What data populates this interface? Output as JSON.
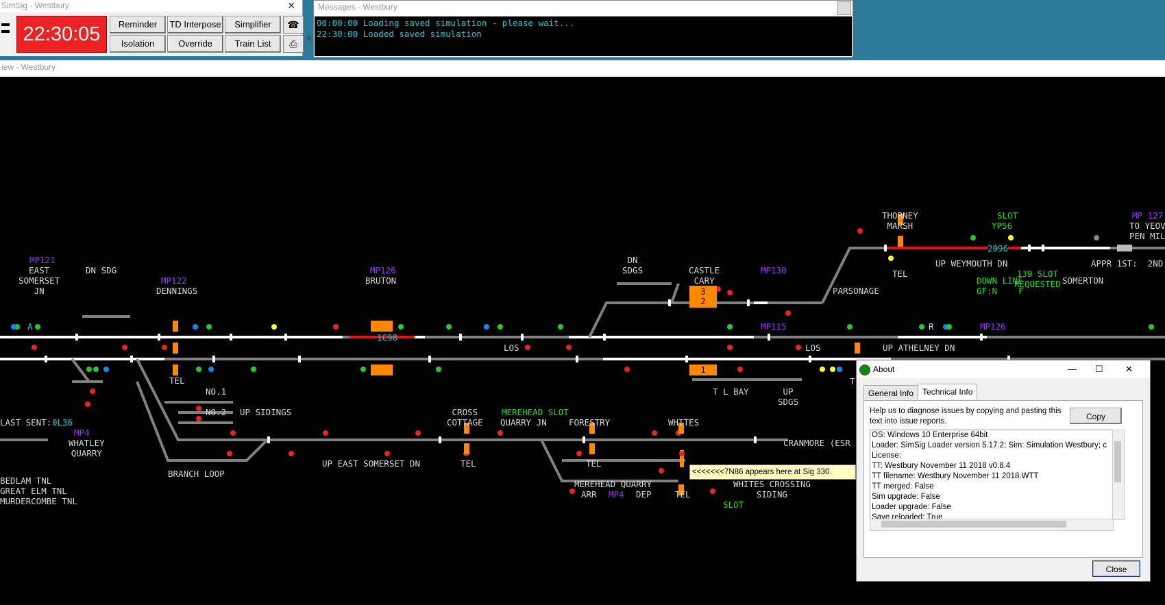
{
  "control": {
    "title": "SimSig - Westbury",
    "clock": "22:30:05",
    "buttons": {
      "reminder": "Reminder",
      "td_interpose": "TD Interpose",
      "simplifier": "Simplifier",
      "isolation": "Isolation",
      "override": "Override",
      "train_list": "Train List"
    },
    "side_char": "6"
  },
  "messages": {
    "title": "Messages - Westbury",
    "lines": [
      "00:00:00 Loading saved simulation - please wait...",
      "22:30:00 Loaded saved simulation"
    ]
  },
  "view": {
    "title": "iew - Westbury",
    "colors": {
      "track_white": "#ffffff",
      "track_grey": "#808080",
      "route_red": "#ee1111",
      "berth": "#ff8800",
      "mp_label": "#9933ff",
      "green_text": "#22dd22",
      "cyan_text": "#22cccc"
    },
    "labels": {
      "mp121": "MP121",
      "east_somerset": "EAST\nSOMERSET\nJN",
      "dn_sdg": "DN SDG",
      "mp122": "MP122",
      "dennings": "DENNINGS",
      "mp126a": "MP126",
      "bruton": "BRUTON",
      "dn_sdgs": "DN\nSDGS",
      "castle_cary": "CASTLE\nCARY",
      "mp130": "MP130",
      "mp115": "MP115",
      "parsonage": "PARSONAGE",
      "down_line": "DOWN LINE",
      "gf_n": "GF:N",
      "f": "F",
      "mp126b": "MP126",
      "somerton": "SOMERTON",
      "thorney_marsh": "THORNEY\nMARSH",
      "slot1": "SLOT",
      "yp56": "YP56",
      "mp127": "MP 127",
      "to_yeov": "TO YEOV",
      "pen_mil": "PEN MIL",
      "appr": "APPR 1ST:  2ND",
      "tel1": "TEL",
      "up_weymouth": "UP WEYMOUTH DN",
      "slot139": "139 SLOT\nREQUESTED",
      "berth_2096": "2096",
      "berth_1c98": "1C98",
      "los1": "LOS",
      "los2": "LOS",
      "up_athelney": "UP ATHELNEY DN",
      "berth_3": "3",
      "berth_2": "2",
      "berth_1": "1",
      "tel2": "TEL",
      "no1": "NO.1",
      "no2": "NO.2",
      "up_sidings": "UP SIDINGS",
      "tl_bay": "T L BAY",
      "up_sdgs": "UP\nSDGS",
      "last_sent": "LAST SENT:",
      "last_sent_val": "0L36",
      "mp4a": "MP4",
      "whatley": "WHATLEY\nQUARRY",
      "cross_cottage": "CROSS\nCOTTAGE",
      "merehead_slot": "MEREHEAD SLOT",
      "quarry_jn": "QUARRY JN",
      "forestry": "FORESTRY",
      "whites": "WHITES",
      "cranmore": "CRANMORE (ESR",
      "up_east_somerset": "UP EAST SOMERSET DN",
      "tel3": "TEL",
      "tel4": "TEL",
      "branch_loop": "BRANCH LOOP",
      "bedlam": "BEDLAM TNL\nGREAT ELM TNL\nMURDERCOMBE TNL",
      "merehead_quarry": "MEREHEAD QUARRY",
      "arr": "ARR",
      "mp4b": "MP4",
      "dep": "DEP",
      "tel5": "TEL",
      "whites_crossing": "WHITES CROSSING\nSIDING",
      "slot2": "SLOT",
      "a": "A",
      "r": "R",
      "t": "T"
    },
    "tooltip": "<<<<<<<7N86 appears here at Sig 330."
  },
  "about": {
    "title": "About",
    "tabs": [
      "General Info",
      "Technical Info"
    ],
    "help": "Help us to diagnose issues by copying and pasting this text into issue reports.",
    "copy": "Copy",
    "info_lines": [
      "OS: Windows 10 Enterprise 64bit",
      "Loader: SimSig Loader version 5.17.2; Sim: Simulation Westbury; c",
      "License:",
      "TT: Westbury November 11 2018 v0.8.4",
      "TT filename: Westbury November 11 2018.WTT",
      "TT merged: False",
      "Sim upgrade: False",
      "Loader upgrade: False",
      "Save reloaded: True"
    ],
    "close": "Close"
  }
}
